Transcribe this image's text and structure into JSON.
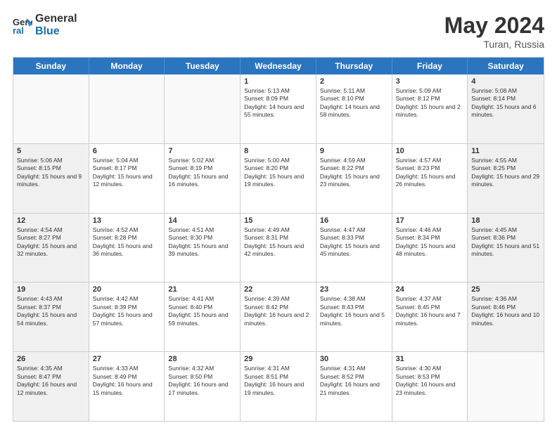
{
  "logo": {
    "general": "General",
    "blue": "Blue"
  },
  "title": {
    "month_year": "May 2024",
    "location": "Turan, Russia"
  },
  "header_days": [
    "Sunday",
    "Monday",
    "Tuesday",
    "Wednesday",
    "Thursday",
    "Friday",
    "Saturday"
  ],
  "weeks": [
    [
      {
        "day": "",
        "sunrise": "",
        "sunset": "",
        "daylight": "",
        "empty": true
      },
      {
        "day": "",
        "sunrise": "",
        "sunset": "",
        "daylight": "",
        "empty": true
      },
      {
        "day": "",
        "sunrise": "",
        "sunset": "",
        "daylight": "",
        "empty": true
      },
      {
        "day": "1",
        "sunrise": "Sunrise: 5:13 AM",
        "sunset": "Sunset: 8:09 PM",
        "daylight": "Daylight: 14 hours and 55 minutes.",
        "empty": false
      },
      {
        "day": "2",
        "sunrise": "Sunrise: 5:11 AM",
        "sunset": "Sunset: 8:10 PM",
        "daylight": "Daylight: 14 hours and 58 minutes.",
        "empty": false
      },
      {
        "day": "3",
        "sunrise": "Sunrise: 5:09 AM",
        "sunset": "Sunset: 8:12 PM",
        "daylight": "Daylight: 15 hours and 2 minutes.",
        "empty": false
      },
      {
        "day": "4",
        "sunrise": "Sunrise: 5:08 AM",
        "sunset": "Sunset: 8:14 PM",
        "daylight": "Daylight: 15 hours and 6 minutes.",
        "empty": false
      }
    ],
    [
      {
        "day": "5",
        "sunrise": "Sunrise: 5:06 AM",
        "sunset": "Sunset: 8:15 PM",
        "daylight": "Daylight: 15 hours and 9 minutes.",
        "empty": false
      },
      {
        "day": "6",
        "sunrise": "Sunrise: 5:04 AM",
        "sunset": "Sunset: 8:17 PM",
        "daylight": "Daylight: 15 hours and 12 minutes.",
        "empty": false
      },
      {
        "day": "7",
        "sunrise": "Sunrise: 5:02 AM",
        "sunset": "Sunset: 8:19 PM",
        "daylight": "Daylight: 15 hours and 16 minutes.",
        "empty": false
      },
      {
        "day": "8",
        "sunrise": "Sunrise: 5:00 AM",
        "sunset": "Sunset: 8:20 PM",
        "daylight": "Daylight: 15 hours and 19 minutes.",
        "empty": false
      },
      {
        "day": "9",
        "sunrise": "Sunrise: 4:59 AM",
        "sunset": "Sunset: 8:22 PM",
        "daylight": "Daylight: 15 hours and 23 minutes.",
        "empty": false
      },
      {
        "day": "10",
        "sunrise": "Sunrise: 4:57 AM",
        "sunset": "Sunset: 8:23 PM",
        "daylight": "Daylight: 15 hours and 26 minutes.",
        "empty": false
      },
      {
        "day": "11",
        "sunrise": "Sunrise: 4:55 AM",
        "sunset": "Sunset: 8:25 PM",
        "daylight": "Daylight: 15 hours and 29 minutes.",
        "empty": false
      }
    ],
    [
      {
        "day": "12",
        "sunrise": "Sunrise: 4:54 AM",
        "sunset": "Sunset: 8:27 PM",
        "daylight": "Daylight: 15 hours and 32 minutes.",
        "empty": false
      },
      {
        "day": "13",
        "sunrise": "Sunrise: 4:52 AM",
        "sunset": "Sunset: 8:28 PM",
        "daylight": "Daylight: 15 hours and 36 minutes.",
        "empty": false
      },
      {
        "day": "14",
        "sunrise": "Sunrise: 4:51 AM",
        "sunset": "Sunset: 8:30 PM",
        "daylight": "Daylight: 15 hours and 39 minutes.",
        "empty": false
      },
      {
        "day": "15",
        "sunrise": "Sunrise: 4:49 AM",
        "sunset": "Sunset: 8:31 PM",
        "daylight": "Daylight: 15 hours and 42 minutes.",
        "empty": false
      },
      {
        "day": "16",
        "sunrise": "Sunrise: 4:47 AM",
        "sunset": "Sunset: 8:33 PM",
        "daylight": "Daylight: 15 hours and 45 minutes.",
        "empty": false
      },
      {
        "day": "17",
        "sunrise": "Sunrise: 4:46 AM",
        "sunset": "Sunset: 8:34 PM",
        "daylight": "Daylight: 15 hours and 48 minutes.",
        "empty": false
      },
      {
        "day": "18",
        "sunrise": "Sunrise: 4:45 AM",
        "sunset": "Sunset: 8:36 PM",
        "daylight": "Daylight: 15 hours and 51 minutes.",
        "empty": false
      }
    ],
    [
      {
        "day": "19",
        "sunrise": "Sunrise: 4:43 AM",
        "sunset": "Sunset: 8:37 PM",
        "daylight": "Daylight: 15 hours and 54 minutes.",
        "empty": false
      },
      {
        "day": "20",
        "sunrise": "Sunrise: 4:42 AM",
        "sunset": "Sunset: 8:39 PM",
        "daylight": "Daylight: 15 hours and 57 minutes.",
        "empty": false
      },
      {
        "day": "21",
        "sunrise": "Sunrise: 4:41 AM",
        "sunset": "Sunset: 8:40 PM",
        "daylight": "Daylight: 15 hours and 59 minutes.",
        "empty": false
      },
      {
        "day": "22",
        "sunrise": "Sunrise: 4:39 AM",
        "sunset": "Sunset: 8:42 PM",
        "daylight": "Daylight: 16 hours and 2 minutes.",
        "empty": false
      },
      {
        "day": "23",
        "sunrise": "Sunrise: 4:38 AM",
        "sunset": "Sunset: 8:43 PM",
        "daylight": "Daylight: 16 hours and 5 minutes.",
        "empty": false
      },
      {
        "day": "24",
        "sunrise": "Sunrise: 4:37 AM",
        "sunset": "Sunset: 8:45 PM",
        "daylight": "Daylight: 16 hours and 7 minutes.",
        "empty": false
      },
      {
        "day": "25",
        "sunrise": "Sunrise: 4:36 AM",
        "sunset": "Sunset: 8:46 PM",
        "daylight": "Daylight: 16 hours and 10 minutes.",
        "empty": false
      }
    ],
    [
      {
        "day": "26",
        "sunrise": "Sunrise: 4:35 AM",
        "sunset": "Sunset: 8:47 PM",
        "daylight": "Daylight: 16 hours and 12 minutes.",
        "empty": false
      },
      {
        "day": "27",
        "sunrise": "Sunrise: 4:33 AM",
        "sunset": "Sunset: 8:49 PM",
        "daylight": "Daylight: 16 hours and 15 minutes.",
        "empty": false
      },
      {
        "day": "28",
        "sunrise": "Sunrise: 4:32 AM",
        "sunset": "Sunset: 8:50 PM",
        "daylight": "Daylight: 16 hours and 17 minutes.",
        "empty": false
      },
      {
        "day": "29",
        "sunrise": "Sunrise: 4:31 AM",
        "sunset": "Sunset: 8:51 PM",
        "daylight": "Daylight: 16 hours and 19 minutes.",
        "empty": false
      },
      {
        "day": "30",
        "sunrise": "Sunrise: 4:31 AM",
        "sunset": "Sunset: 8:52 PM",
        "daylight": "Daylight: 16 hours and 21 minutes.",
        "empty": false
      },
      {
        "day": "31",
        "sunrise": "Sunrise: 4:30 AM",
        "sunset": "Sunset: 8:53 PM",
        "daylight": "Daylight: 16 hours and 23 minutes.",
        "empty": false
      },
      {
        "day": "",
        "sunrise": "",
        "sunset": "",
        "daylight": "",
        "empty": true
      }
    ]
  ]
}
